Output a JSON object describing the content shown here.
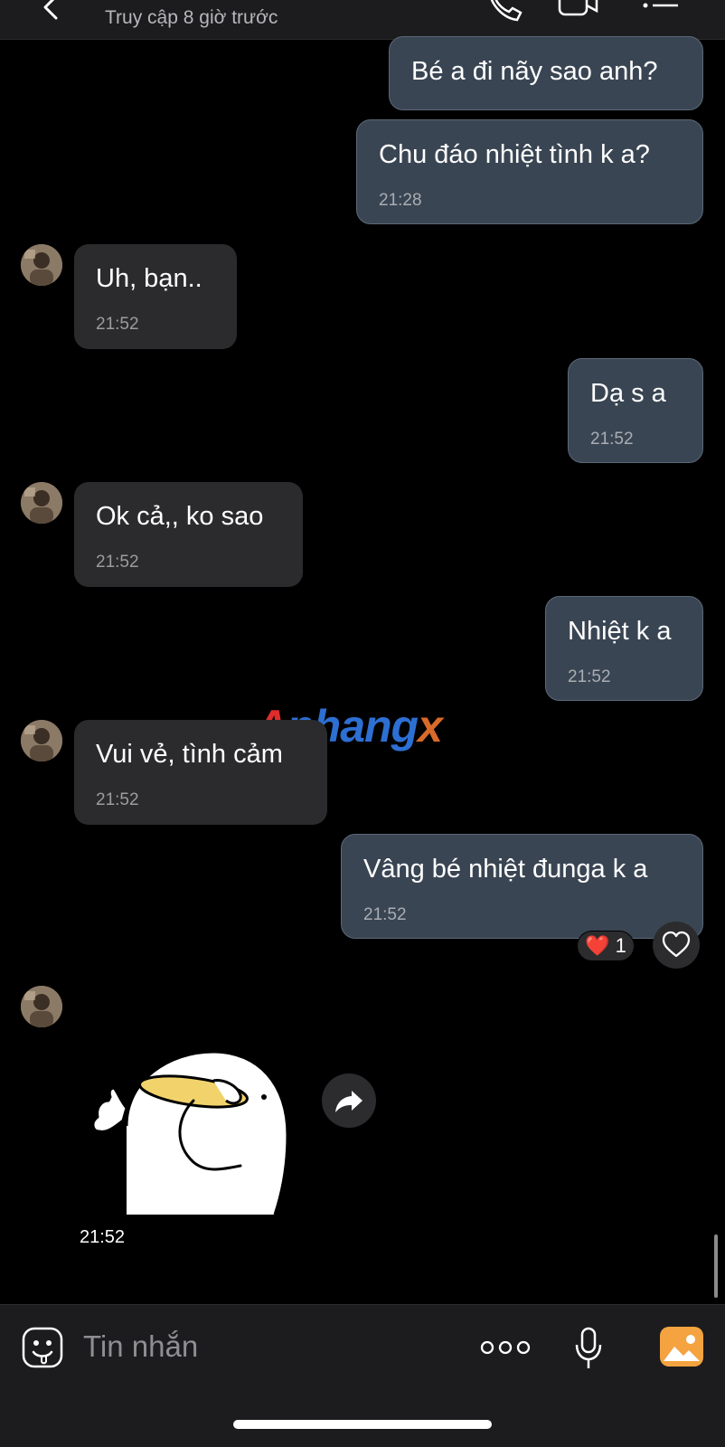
{
  "header": {
    "status": "Truy cập 8 giờ trước",
    "icons": [
      "back-arrow-icon",
      "phone-icon",
      "video-call-icon",
      "menu-list-icon"
    ]
  },
  "messages": [
    {
      "dir": "out",
      "text": "Bé a đi nãy sao anh?",
      "time": ""
    },
    {
      "dir": "out",
      "text": "Chu đáo nhiệt tình k a?",
      "time": "21:28"
    },
    {
      "dir": "in",
      "text": "Uh, bạn..",
      "time": "21:52"
    },
    {
      "dir": "out",
      "text": "Dạ s a",
      "time": "21:52"
    },
    {
      "dir": "in",
      "text": "Ok cả,, ko sao",
      "time": "21:52"
    },
    {
      "dir": "out",
      "text": "Nhiệt k a",
      "time": "21:52"
    },
    {
      "dir": "in",
      "text": "Vui vẻ, tình cảm",
      "time": "21:52"
    },
    {
      "dir": "out",
      "text": "Vâng bé nhiệt đunga k a",
      "time": "21:52"
    }
  ],
  "reaction": {
    "emoji": "❤️",
    "count": "1"
  },
  "sticker": {
    "time": "21:52"
  },
  "watermark": {
    "part1": "A",
    "part2": "phang",
    "part3": "x"
  },
  "composer": {
    "placeholder": "Tin nhắn"
  },
  "colors": {
    "outgoing_bubble": "#3a4553",
    "incoming_bubble": "#2b2b2d",
    "photo_button": "#f4a340"
  }
}
